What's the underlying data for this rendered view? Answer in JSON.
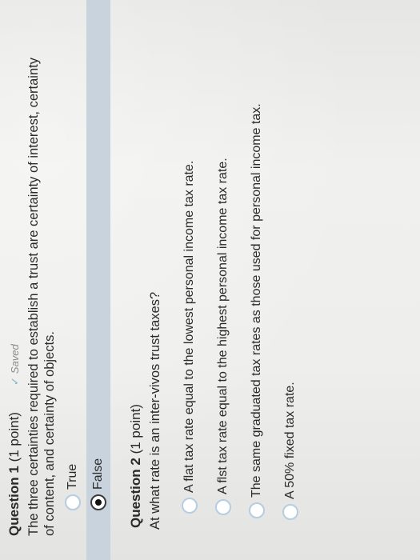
{
  "question1": {
    "number_label": "Question 1",
    "points": "(1 point)",
    "saved_label": "Saved",
    "text_line1": "The three certainties required to establish a trust are certainty of interest, certainty",
    "text_line2": "of content, and certainty of objects.",
    "options": [
      {
        "label": "True",
        "selected": false
      },
      {
        "label": "False",
        "selected": true
      }
    ]
  },
  "question2": {
    "number_label": "Question 2",
    "points": "(1 point)",
    "text": "At what rate is an inter-vivos trust taxes?",
    "options": [
      {
        "label": "A flat tax rate equal to the lowest personal income tax rate.",
        "selected": false
      },
      {
        "label": "A flst tax rate equal to the highest personal income tax rate.",
        "selected": false
      },
      {
        "label": "The same graduated tax rates as those used for personal income tax.",
        "selected": false
      },
      {
        "label": "A 50% fixed tax rate.",
        "selected": false
      }
    ]
  },
  "colors": {
    "selected_row_bg": "#c9d3de",
    "radio_border": "#b5cde0",
    "saved_check": "#7fb0c8"
  }
}
